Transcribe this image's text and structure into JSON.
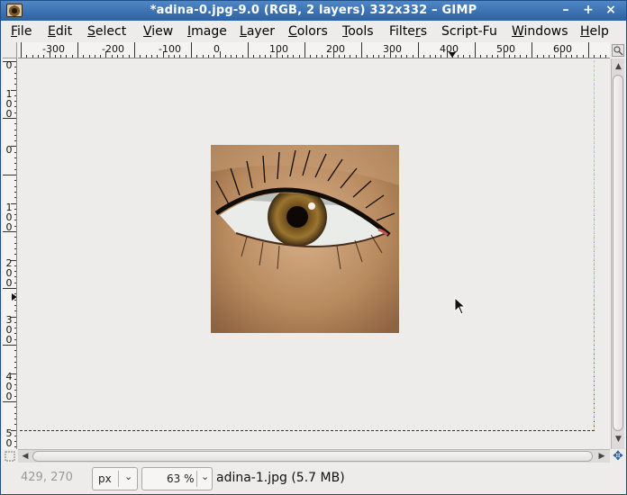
{
  "window": {
    "title": "*adina-0.jpg-9.0 (RGB, 2 layers) 332x332 – GIMP",
    "controls": {
      "minimize": "–",
      "maximize": "+",
      "close": "×"
    }
  },
  "menubar": {
    "items": [
      {
        "label": "File",
        "mnemonic": "F",
        "rest": "ile"
      },
      {
        "label": "Edit",
        "mnemonic": "E",
        "rest": "dit"
      },
      {
        "label": "Select",
        "mnemonic": "S",
        "rest": "elect"
      },
      {
        "label": "View",
        "mnemonic": "V",
        "rest": "iew"
      },
      {
        "label": "Image",
        "mnemonic": "I",
        "rest": "mage"
      },
      {
        "label": "Layer",
        "mnemonic": "L",
        "rest": "ayer"
      },
      {
        "label": "Colors",
        "mnemonic": "C",
        "rest": "olors"
      },
      {
        "label": "Tools",
        "mnemonic": "T",
        "rest": "ools"
      },
      {
        "label": "Filters",
        "mnemonic": "r",
        "pre": "Filte",
        "rest": "s"
      },
      {
        "label": "Script-Fu",
        "mnemonic": "",
        "rest": "Script-Fu"
      },
      {
        "label": "Windows",
        "mnemonic": "W",
        "rest": "indows"
      },
      {
        "label": "Help",
        "mnemonic": "H",
        "rest": "elp"
      }
    ]
  },
  "ruler_h": {
    "labels": [
      "300",
      "200",
      "100",
      "0",
      "100",
      "200",
      "300",
      "400",
      "500",
      "600"
    ]
  },
  "ruler_v": {
    "labels": [
      "0",
      "100",
      "200",
      "300",
      "400",
      "500"
    ]
  },
  "statusbar": {
    "coordinates": "429, 270",
    "unit": "px",
    "zoom": "63 %",
    "message": "adina-1.jpg (5.7 MB)"
  },
  "icons": {
    "app": "gimp-eye-icon",
    "navigate": "navigate-icon",
    "quickmask": "quick-mask-icon",
    "zoom_fit": "zoom-image-icon"
  }
}
